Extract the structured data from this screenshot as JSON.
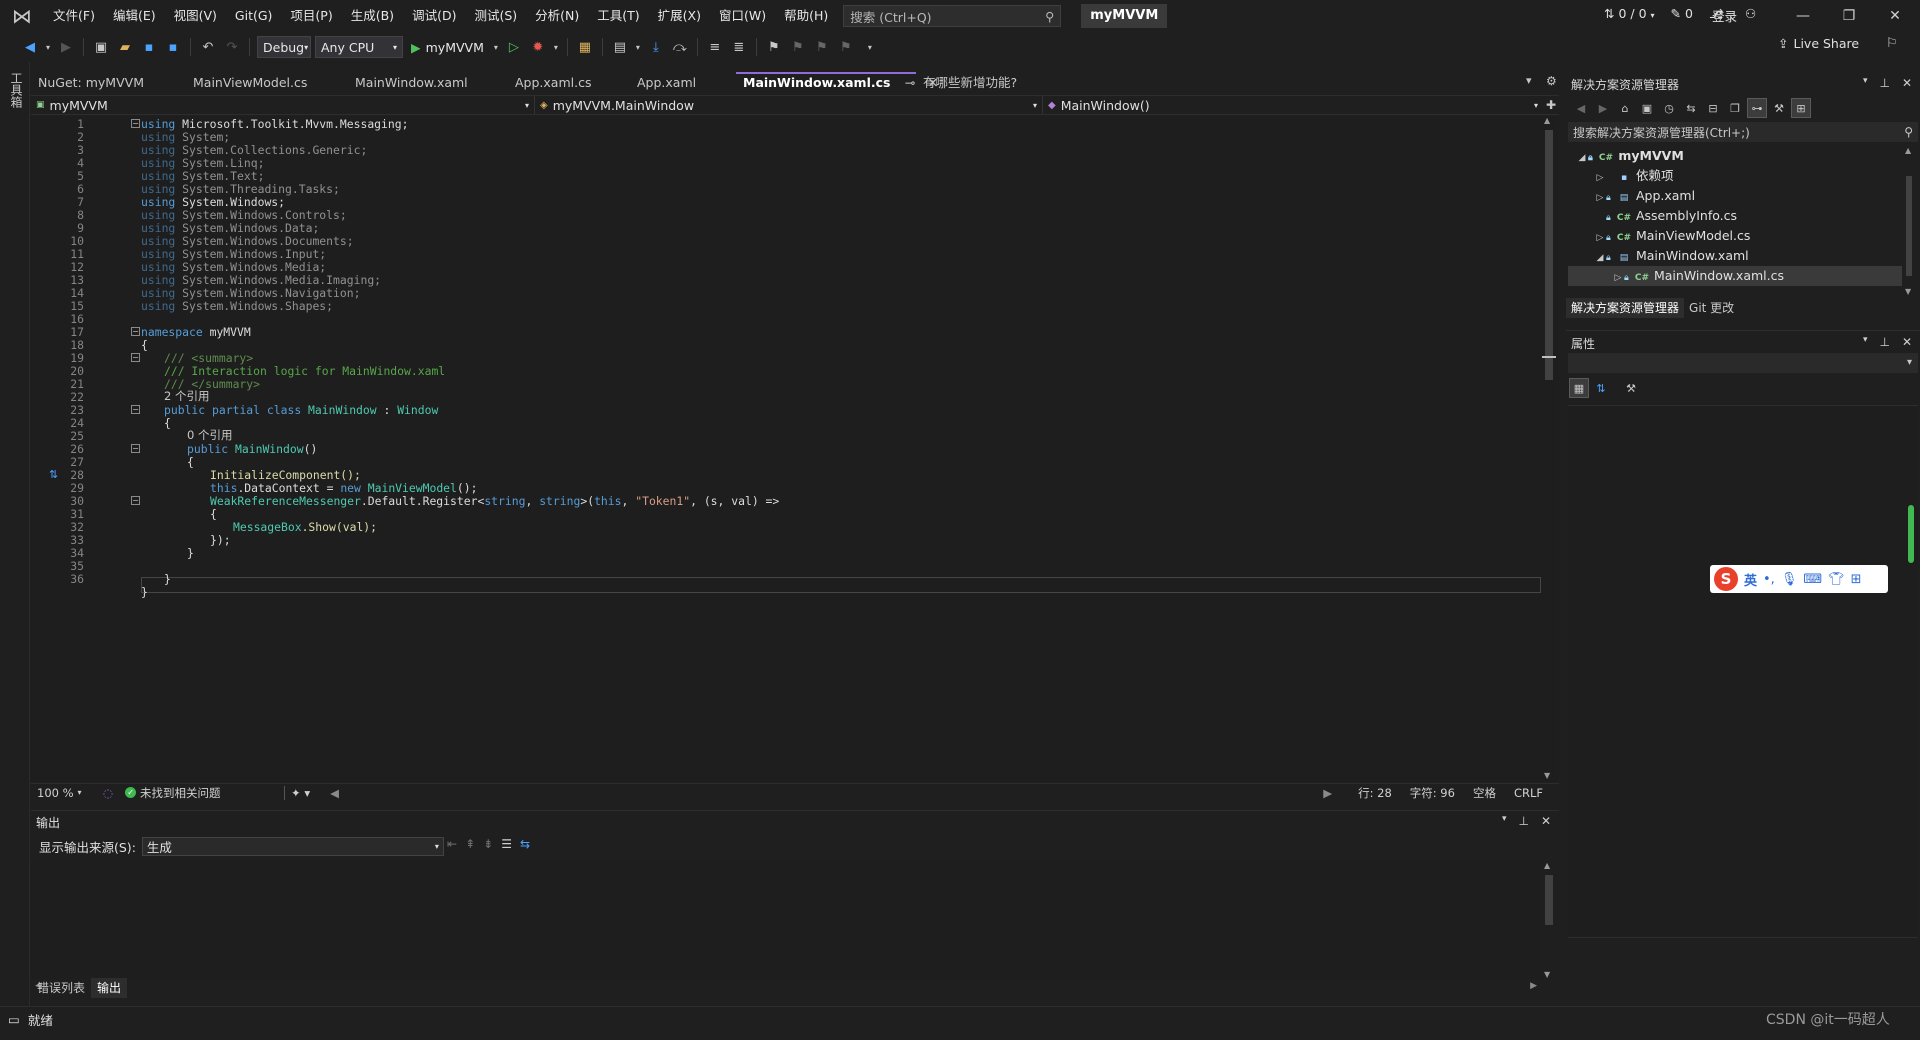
{
  "app": {
    "menu": [
      "文件(F)",
      "编辑(E)",
      "视图(V)",
      "Git(G)",
      "项目(P)",
      "生成(B)",
      "调试(D)",
      "测试(S)",
      "分析(N)",
      "工具(T)",
      "扩展(X)",
      "窗口(W)",
      "帮助(H)"
    ],
    "search_placeholder": "搜索 (Ctrl+Q)",
    "solution_name": "myMVVM",
    "login": "登录"
  },
  "toolbar": {
    "config": "Debug",
    "platform": "Any CPU",
    "start_target": "myMVVM",
    "live_share": "Live Share"
  },
  "left_strip": {
    "toolbox": "工具箱"
  },
  "editor": {
    "tabs": [
      "NuGet: myMVVM",
      "MainViewModel.cs",
      "MainWindow.xaml",
      "App.xaml.cs",
      "App.xaml",
      "MainWindow.xaml.cs",
      "有哪些新增功能?"
    ],
    "active_tab": "MainWindow.xaml.cs",
    "nav": {
      "project": "myMVVM",
      "type": "myMVVM.MainWindow",
      "member": "MainWindow()"
    },
    "hints": {
      "refs2": "2 个引用",
      "refs0": "0 个引用"
    },
    "line_numbers": [
      "1",
      "2",
      "3",
      "4",
      "5",
      "6",
      "7",
      "8",
      "9",
      "10",
      "11",
      "12",
      "13",
      "14",
      "15",
      "16",
      "17",
      "18",
      "19",
      "20",
      "21",
      "22",
      "23",
      "24",
      "25",
      "26",
      "27",
      "28",
      "29",
      "30",
      "31",
      "32",
      "33",
      "34",
      "35",
      "36"
    ],
    "status": {
      "zoom": "100 %",
      "issues": "未找到相关问题",
      "line": "行: 28",
      "char": "字符: 96",
      "spaces": "空格",
      "eol": "CRLF"
    }
  },
  "code": {
    "using": "using",
    "namespaces": [
      "Microsoft.Toolkit.Mvvm.Messaging;",
      "System;",
      "System.Collections.Generic;",
      "System.Linq;",
      "System.Text;",
      "System.Threading.Tasks;",
      "System.Windows;",
      "System.Windows.Controls;",
      "System.Windows.Data;",
      "System.Windows.Documents;",
      "System.Windows.Input;",
      "System.Windows.Media;",
      "System.Windows.Media.Imaging;",
      "System.Windows.Navigation;",
      "System.Windows.Shapes;"
    ],
    "namespace_kw": "namespace",
    "namespace_name": "myMVVM",
    "doc1": "/// <summary>",
    "doc2": "/// Interaction logic for MainWindow.xaml",
    "doc3": "/// </summary>",
    "public": "public",
    "partial": "partial",
    "class": "class",
    "class_name": "MainWindow",
    "colon": " : ",
    "base": "Window",
    "ctor": "MainWindow",
    "parens": "()",
    "init": "InitializeComponent();",
    "this": "this",
    "datacontext": ".DataContext = ",
    "new": "new",
    "vm": "MainViewModel",
    "vm_tail": "();",
    "messenger": "WeakReferenceMessenger",
    "register": ".Default.Register<",
    "string": "string",
    "comma": ", ",
    "generic_close": ">(",
    "token_arg": ", ",
    "token": "\"Token1\"",
    "lambda": ", (s, val) =>",
    "msgbox": "MessageBox",
    "show": ".Show(val);",
    "lambda_close": "});",
    "open_brace": "{",
    "close_brace": "}"
  },
  "output": {
    "title": "输出",
    "source_label": "显示输出来源(S):",
    "source_value": "生成"
  },
  "bottom_tabs": [
    "错误列表",
    "输出"
  ],
  "solution_explorer": {
    "title": "解决方案资源管理器",
    "search": "搜索解决方案资源管理器(Ctrl+;)",
    "tree": [
      {
        "label": "myMVVM",
        "icon": "C#",
        "level": 0
      },
      {
        "label": "依赖项",
        "icon": "▪",
        "level": 1
      },
      {
        "label": "App.xaml",
        "icon": "▤",
        "level": 1
      },
      {
        "label": "AssemblyInfo.cs",
        "icon": "C#",
        "level": 1
      },
      {
        "label": "MainViewModel.cs",
        "icon": "C#",
        "level": 1
      },
      {
        "label": "MainWindow.xaml",
        "icon": "▤",
        "level": 1
      },
      {
        "label": "MainWindow.xaml.cs",
        "icon": "C#",
        "level": 2
      }
    ],
    "tabs": [
      "解决方案资源管理器",
      "Git 更改"
    ]
  },
  "properties": {
    "title": "属性"
  },
  "ime": {
    "mode": "英"
  },
  "statusbar": {
    "ready": "就绪",
    "updown": "0 / 0",
    "pencil": "0",
    "watermark": "CSDN @it一码超人"
  },
  "colors": {
    "accent": "#8f6dd6",
    "keyword": "#569cd6",
    "type": "#4ec9b0",
    "comment": "#57a64a",
    "string": "#d69d85"
  }
}
